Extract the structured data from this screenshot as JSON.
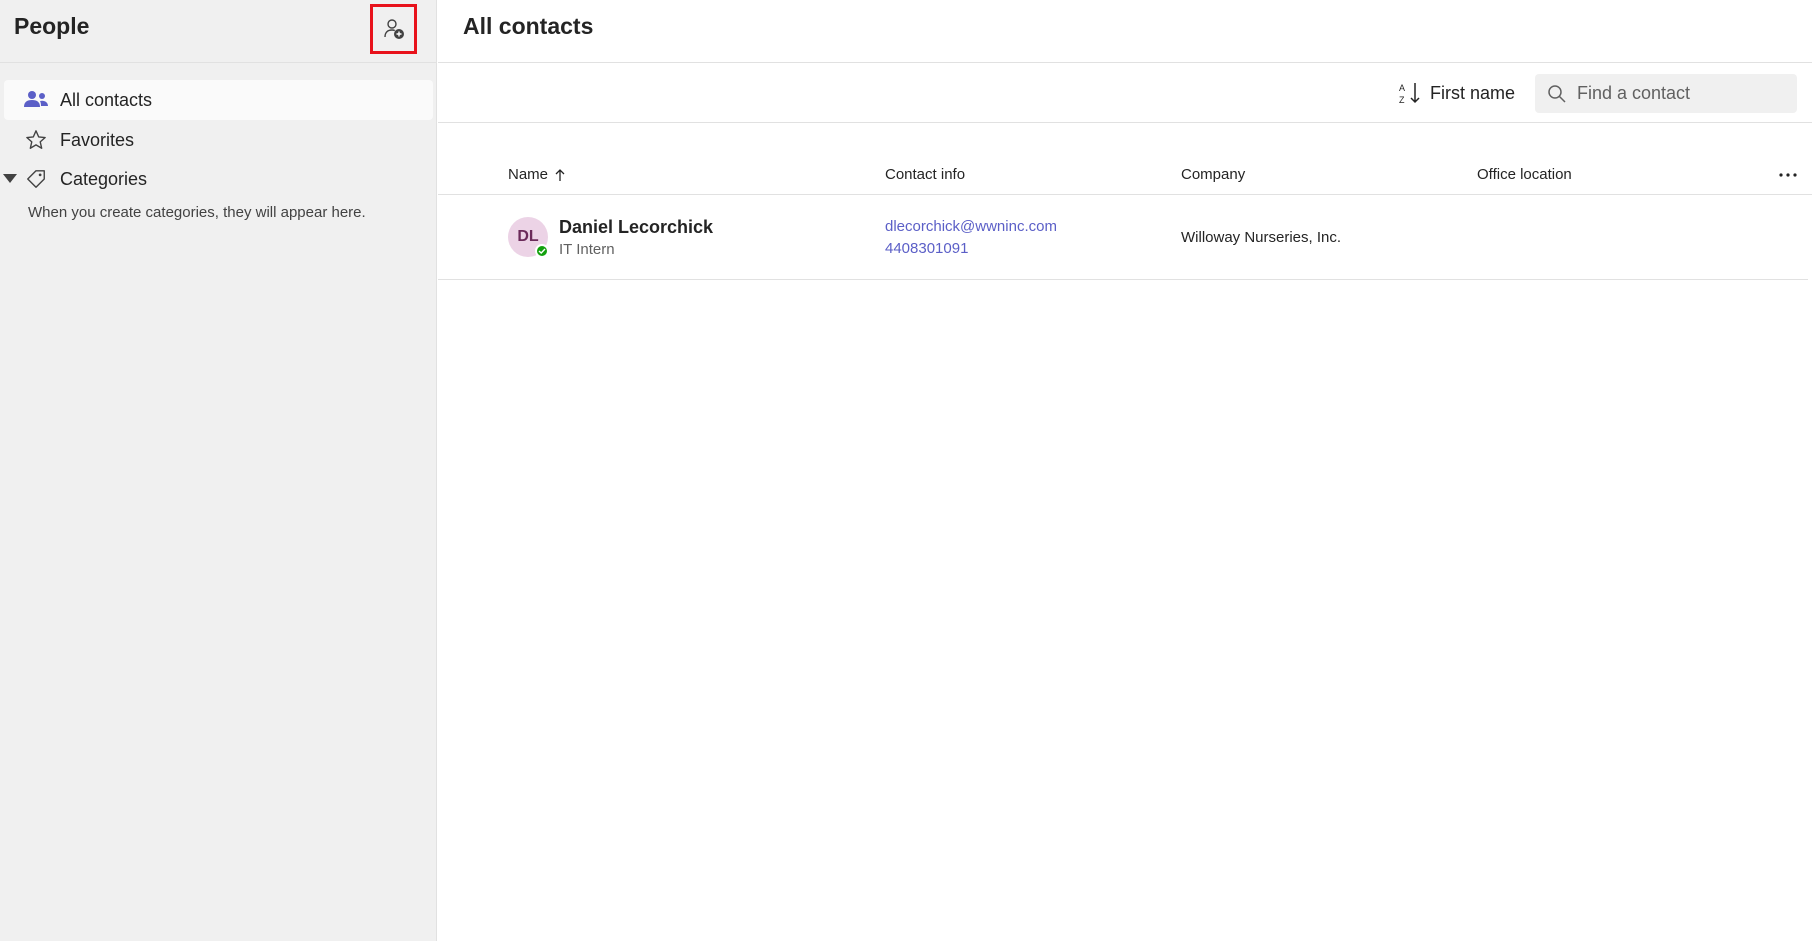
{
  "sidebar": {
    "title": "People",
    "add_contact_icon": "person-add-icon",
    "items": [
      {
        "label": "All contacts",
        "icon": "people-icon",
        "active": true
      },
      {
        "label": "Favorites",
        "icon": "star-icon",
        "active": false
      },
      {
        "label": "Categories",
        "icon": "tag-icon",
        "active": false
      }
    ],
    "categories_hint": "When you create categories, they will appear here."
  },
  "main": {
    "title": "All contacts",
    "sort_label": "First name",
    "search_placeholder": "Find a contact",
    "columns": {
      "name": "Name",
      "contact_info": "Contact info",
      "company": "Company",
      "office_location": "Office location"
    },
    "contacts": [
      {
        "initials": "DL",
        "name": "Daniel Lecorchick",
        "title": "IT Intern",
        "email": "dlecorchick@wwninc.com",
        "phone": "4408301091",
        "company": "Willoway Nurseries, Inc.",
        "office_location": "",
        "presence": "available"
      }
    ]
  },
  "colors": {
    "accent": "#5b5fc7",
    "sidebar_bg": "#f0f0f0",
    "highlight_box": "#e8121b",
    "presence_available": "#13a10e",
    "avatar_bg": "#ecd3e6"
  }
}
